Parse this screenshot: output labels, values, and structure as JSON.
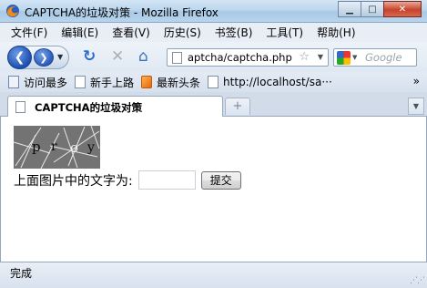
{
  "window": {
    "title": "CAPTCHA的垃圾对策 - Mozilla Firefox",
    "minimize_label": "▁",
    "maximize_label": "□",
    "close_label": "✕"
  },
  "menu": {
    "items": [
      {
        "label": "文件(F)"
      },
      {
        "label": "编辑(E)"
      },
      {
        "label": "查看(V)"
      },
      {
        "label": "历史(S)"
      },
      {
        "label": "书签(B)"
      },
      {
        "label": "工具(T)"
      },
      {
        "label": "帮助(H)"
      }
    ]
  },
  "toolbar": {
    "back_icon": "back-arrow-icon",
    "forward_icon": "forward-arrow-icon",
    "reload_glyph": "↻",
    "stop_glyph": "✕",
    "home_glyph": "⌂",
    "url": "aptcha/captcha.php",
    "search_placeholder": "Google"
  },
  "bookmarks": {
    "items": [
      {
        "label": "访问最多",
        "icon": "most-visited-icon"
      },
      {
        "label": "新手上路",
        "icon": "page-icon"
      },
      {
        "label": "最新头条",
        "icon": "rss-icon"
      },
      {
        "label": "http://localhost/sa···",
        "icon": "page-icon"
      }
    ],
    "overflow_glyph": "»"
  },
  "tabs": {
    "active_label": "CAPTCHA的垃圾对策",
    "new_tab_glyph": "+",
    "list_glyph": "▼"
  },
  "content": {
    "captcha_chars": [
      "p",
      "r",
      "o",
      "y"
    ],
    "prompt_label": "上面图片中的文字为:",
    "answer_value": "",
    "submit_label": "提交"
  },
  "status": {
    "text": "完成"
  }
}
